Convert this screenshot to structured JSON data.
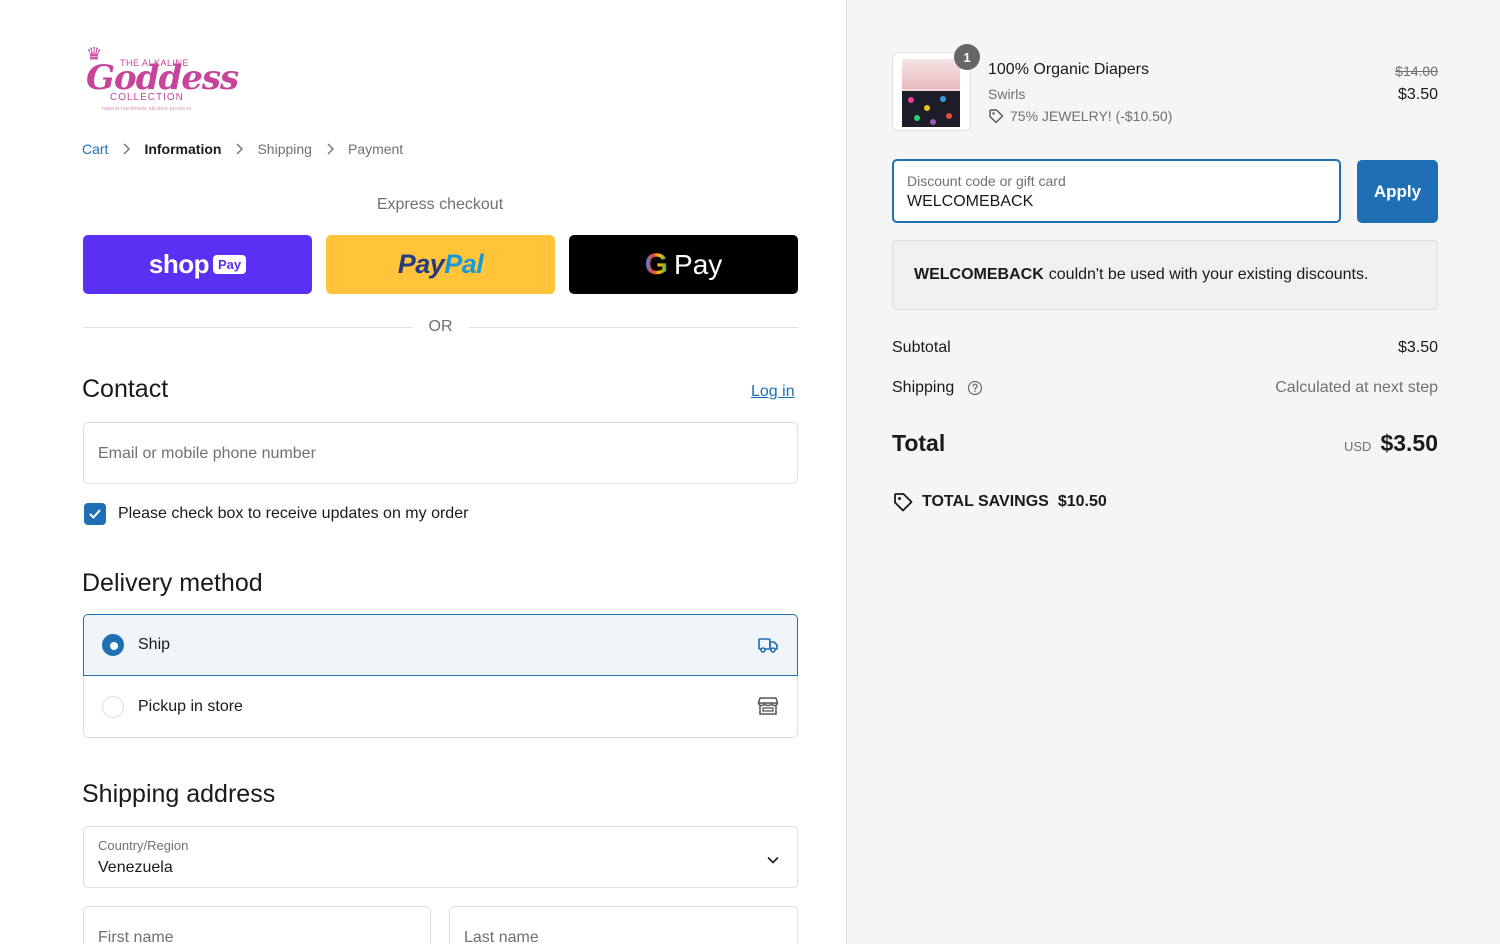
{
  "brand": {
    "logo_top": "THE ALKALINE",
    "logo_main": "Goddess",
    "logo_bottom": "COLLECTION",
    "logo_tagline": "natural handmade alkaline products",
    "accent": "#c8449a"
  },
  "breadcrumb": {
    "items": [
      {
        "label": "Cart"
      },
      {
        "label": "Information"
      },
      {
        "label": "Shipping"
      },
      {
        "label": "Payment"
      }
    ]
  },
  "express": {
    "label": "Express checkout",
    "shop_text": "shop",
    "shop_pay": "Pay",
    "paypal_a": "Pay",
    "paypal_b": "Pal",
    "gpay_g": "G",
    "gpay_text": "Pay"
  },
  "or_label": "OR",
  "contact": {
    "title": "Contact",
    "login": "Log in",
    "email_placeholder": "Email or mobile phone number",
    "checkbox_label": "Please check box to receive updates on my order",
    "checkbox_checked": true
  },
  "delivery": {
    "title": "Delivery method",
    "options": [
      {
        "label": "Ship",
        "selected": true,
        "icon": "truck-icon"
      },
      {
        "label": "Pickup in store",
        "selected": false,
        "icon": "store-icon"
      }
    ]
  },
  "shipping_address": {
    "title": "Shipping address",
    "country_label": "Country/Region",
    "country_value": "Venezuela",
    "first_name_placeholder": "First name",
    "last_name_placeholder": "Last name"
  },
  "order": {
    "quantity": "1",
    "product_name": "100% Organic Diapers",
    "variant": "Swirls",
    "discount_line": "75% JEWELRY! (-$10.50)",
    "price_original": "$14.00",
    "price_final": "$3.50"
  },
  "discount": {
    "label": "Discount code or gift card",
    "value": "WELCOMEBACK",
    "apply": "Apply",
    "notice_code": "WELCOMEBACK",
    "notice_text": "couldn't be used with your existing discounts."
  },
  "summary": {
    "subtotal_label": "Subtotal",
    "subtotal_value": "$3.50",
    "shipping_label": "Shipping",
    "shipping_value": "Calculated at next step",
    "total_label": "Total",
    "currency": "USD",
    "total_value": "$3.50",
    "savings_label": "TOTAL SAVINGS",
    "savings_value": "$10.50"
  },
  "colors": {
    "primary": "#1f6fb5",
    "shop_pay": "#5a31f4",
    "paypal": "#ffc439",
    "gpay": "#000000"
  }
}
